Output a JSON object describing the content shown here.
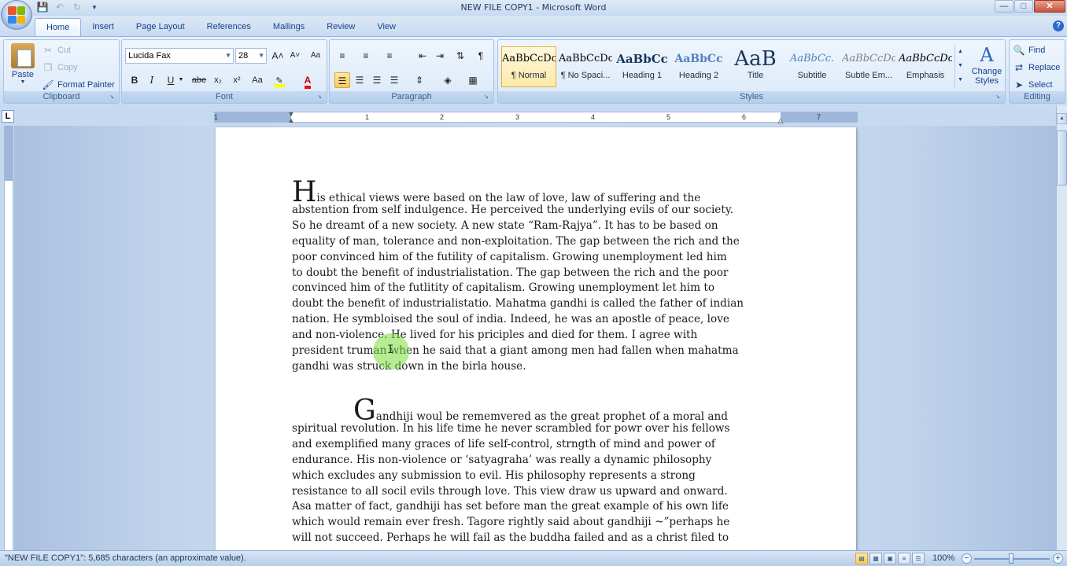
{
  "window": {
    "title": "NEW FILE COPY1 - Microsoft Word",
    "controls": {
      "minimize": "—",
      "maximize": "□",
      "close": "✕"
    }
  },
  "qat": {
    "save_icon": "save-icon",
    "undo_icon": "undo-icon",
    "redo_icon": "redo-icon"
  },
  "tabs": [
    "Home",
    "Insert",
    "Page Layout",
    "References",
    "Mailings",
    "Review",
    "View"
  ],
  "active_tab": "Home",
  "clipboard": {
    "paste": "Paste",
    "cut": "Cut",
    "copy": "Copy",
    "format_painter": "Format Painter",
    "label": "Clipboard"
  },
  "font": {
    "name": "Lucida Fax",
    "size": "28",
    "grow": "A˄",
    "shrink": "A˅",
    "clear": "Aa",
    "bold": "B",
    "italic": "I",
    "underline": "U",
    "strike": "abe",
    "subscript": "x₂",
    "superscript": "x²",
    "change_case": "Aa",
    "label": "Font"
  },
  "paragraph": {
    "label": "Paragraph",
    "pilcrow": "¶"
  },
  "styles": {
    "label": "Styles",
    "items": [
      {
        "sample": "AaBbCcDc",
        "name": "¶ Normal"
      },
      {
        "sample": "AaBbCcDc",
        "name": "¶ No Spaci..."
      },
      {
        "sample": "AaBbCc",
        "name": "Heading 1"
      },
      {
        "sample": "AaBbCc",
        "name": "Heading 2"
      },
      {
        "sample": "AaB",
        "name": "Title"
      },
      {
        "sample": "AaBbCc.",
        "name": "Subtitle"
      },
      {
        "sample": "AaBbCcDc",
        "name": "Subtle Em..."
      },
      {
        "sample": "AaBbCcDc",
        "name": "Emphasis"
      }
    ],
    "change_styles": "Change Styles"
  },
  "editing": {
    "find": "Find",
    "replace": "Replace",
    "select": "Select",
    "label": "Editing"
  },
  "ruler": {
    "numbers": [
      "1",
      "1",
      "2",
      "3",
      "4",
      "5",
      "6",
      "7"
    ],
    "tab_selector": "L"
  },
  "document": {
    "para1": {
      "drop_cap": "H",
      "first_line": "is  ethical views were based on the law of love, law of suffering and the",
      "lines": [
        "abstention from self indulgence. He perceived the underlying evils of our society.",
        "So he dreamt of a new society. A new state “Ram-Rajya”. It has to be based on",
        "equality of man, tolerance and non-exploitation. The gap between the rich and the",
        "poor convinced him of the futility of capitalism. Growing unemployment led him",
        "to doubt the benefit of industrialistation. The gap between the rich and the poor",
        "convinced him of the futlitity of capitalism. Growing unemployment let him to",
        "doubt the benefit of industrialistatio. Mahatma gandhi is called the father of indian",
        "nation. He symbloised the soul of india. Indeed, he was an apostle of peace, love",
        "and non-violence. He lived for his priciples and died for them. I agree with",
        "president truman when he said that a giant among men had fallen when mahatma",
        "gandhi was struck down in the birla house."
      ]
    },
    "para2": {
      "drop_cap": "G",
      "first_line": "andhiji woul be rememvered as the great prophet of a moral and",
      "lines": [
        "spiritual revolution. In his life time he never scrambled for powr over his fellows",
        "and exemplified many graces of life self-control, strngth of mind and power of",
        "endurance. His non-violence or ‘satyagraha’ was really a dynamic philosophy",
        "which excludes any submission to evil. His philosophy represents a strong",
        "resistance to all socil evils through love. This view draw us upward and onward.",
        "Asa matter of fact, gandhiji has set before man the great example of his own life",
        "which would remain ever fresh. Tagore rightly said about gandhiji ~”perhaps he",
        "will not succeed. Perhaps he will fail as the buddha failed and as a christ filed to"
      ]
    }
  },
  "status": {
    "text": "\"NEW FILE COPY1\": 5,685 characters (an approximate value).",
    "zoom": "100%"
  }
}
